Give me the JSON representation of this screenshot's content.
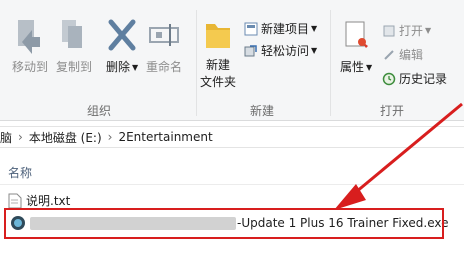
{
  "ribbon": {
    "organize": {
      "group_label": "组织",
      "move_to": "移动到",
      "copy_to": "复制到",
      "delete": "删除",
      "rename": "重命名"
    },
    "new": {
      "group_label": "新建",
      "new_folder_line1": "新建",
      "new_folder_line2": "文件夹",
      "new_item": "新建项目",
      "easy_access": "轻松访问"
    },
    "open": {
      "group_label": "打开",
      "properties": "属性",
      "open": "打开",
      "edit": "编辑",
      "history": "历史记录"
    }
  },
  "address": {
    "crumbs": [
      "脑",
      "本地磁盘 (E:)",
      "2Entertainment"
    ]
  },
  "columns": {
    "name": "名称"
  },
  "files": [
    {
      "name": "说明.txt"
    },
    {
      "name_visible_suffix": "-Update 1 Plus 16 Trainer Fixed.exe"
    }
  ],
  "colors": {
    "annotation_red": "#d81e1e"
  }
}
